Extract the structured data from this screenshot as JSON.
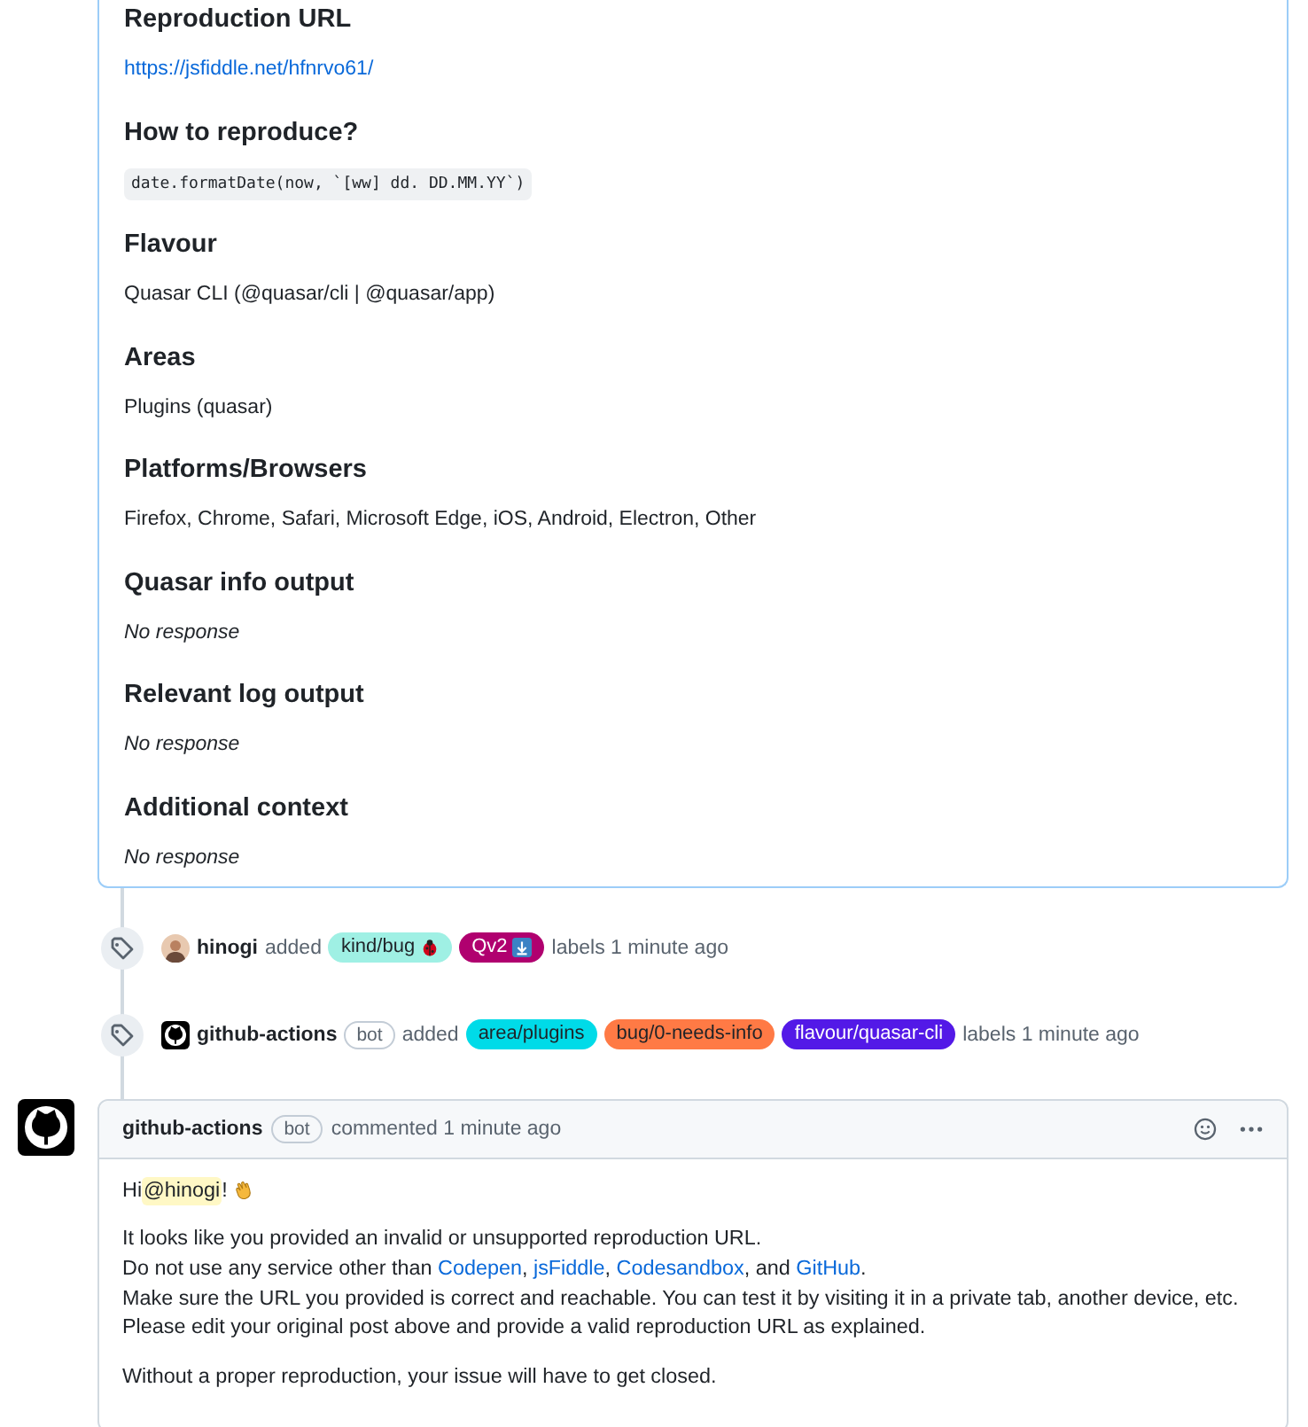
{
  "form_sections": [
    {
      "heading": "Reproduction URL",
      "kind": "link",
      "text": "https://jsfiddle.net/hfnrvo61/"
    },
    {
      "heading": "How to reproduce?",
      "kind": "code",
      "text": "date.formatDate(now, `[ww] dd. DD.MM.YY`)"
    },
    {
      "heading": "Flavour",
      "kind": "text",
      "text": "Quasar CLI (@quasar/cli | @quasar/app)"
    },
    {
      "heading": "Areas",
      "kind": "text",
      "text": "Plugins (quasar)"
    },
    {
      "heading": "Platforms/Browsers",
      "kind": "text",
      "text": "Firefox, Chrome, Safari, Microsoft Edge, iOS, Android, Electron, Other"
    },
    {
      "heading": "Quasar info output",
      "kind": "empty",
      "text": "No response"
    },
    {
      "heading": "Relevant log output",
      "kind": "empty",
      "text": "No response"
    },
    {
      "heading": "Additional context",
      "kind": "empty",
      "text": "No response"
    }
  ],
  "events": [
    {
      "actor": "hinogi",
      "verb": "added",
      "labels": [
        {
          "name": "kind/bug",
          "color": "#9ff0e4"
        },
        {
          "name": "Qv2",
          "color": "#b0006f"
        }
      ],
      "suffix": "labels 1 minute ago"
    },
    {
      "actor": "github-actions",
      "badge": "bot",
      "verb": "added",
      "labels": [
        {
          "name": "area/plugins",
          "color": "#00dbe8"
        },
        {
          "name": "bug/0-needs-info",
          "color": "#ff7a45"
        },
        {
          "name": "flavour/quasar-cli",
          "color": "#5319e7"
        }
      ],
      "suffix": "labels 1 minute ago"
    }
  ],
  "comment": {
    "author": "github-actions",
    "badge": "bot",
    "meta": "commented 1 minute ago",
    "greeting": {
      "before": "Hi ",
      "mention": "@hinogi",
      "after": "!"
    },
    "paragraphs": [
      [
        [
          {
            "kind": "text",
            "text": "It looks like you provided an invalid or unsupported reproduction URL."
          }
        ],
        [
          {
            "kind": "text",
            "text": "Do not use any service other than "
          },
          {
            "kind": "link",
            "text": "Codepen"
          },
          {
            "kind": "text",
            "text": ", "
          },
          {
            "kind": "link",
            "text": "jsFiddle"
          },
          {
            "kind": "text",
            "text": ", "
          },
          {
            "kind": "link",
            "text": "Codesandbox"
          },
          {
            "kind": "text",
            "text": ", and "
          },
          {
            "kind": "link",
            "text": "GitHub"
          },
          {
            "kind": "text",
            "text": "."
          }
        ],
        [
          {
            "kind": "text",
            "text": "Make sure the URL you provided is correct and reachable. You can test it by visiting it in a private tab, another device, etc."
          }
        ],
        [
          {
            "kind": "text",
            "text": "Please edit your original post above and provide a valid reproduction URL as explained."
          }
        ]
      ],
      [
        [
          {
            "kind": "text",
            "text": "Without a proper reproduction, your issue will have to get closed."
          }
        ]
      ]
    ]
  }
}
